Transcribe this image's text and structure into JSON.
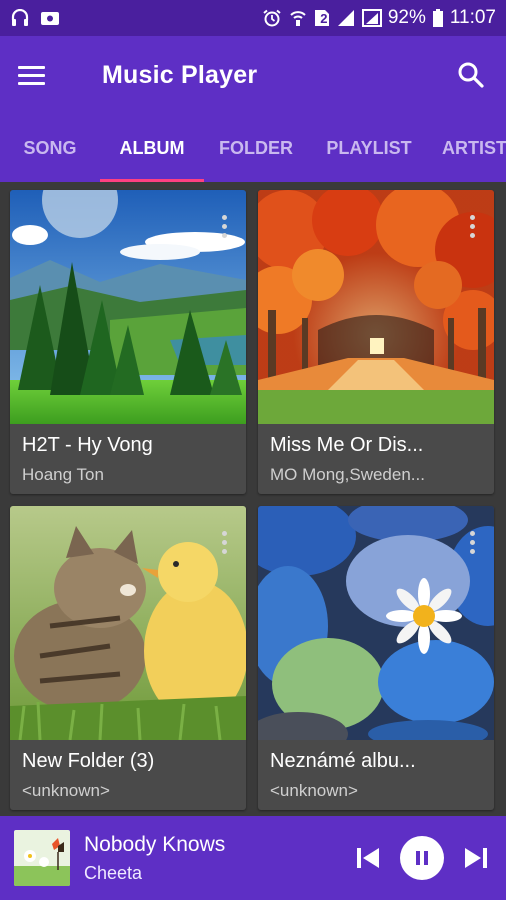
{
  "status_bar": {
    "battery_percent": "92%",
    "time": "11:07",
    "sim_label": "2",
    "icons_left": [
      "headset-icon",
      "image-notification-icon"
    ],
    "icons_right": [
      "alarm-icon",
      "wifi-calling-icon",
      "sim-icon",
      "signal-icon",
      "signal-r-icon",
      "battery-icon"
    ]
  },
  "app_bar": {
    "title": "Music Player"
  },
  "tabs": [
    {
      "label": "SONG",
      "active": false
    },
    {
      "label": "ALBUM",
      "active": true
    },
    {
      "label": "FOLDER",
      "active": false
    },
    {
      "label": "PLAYLIST",
      "active": false
    },
    {
      "label": "ARTIST",
      "active": false
    }
  ],
  "albums": [
    {
      "title": "H2T - Hy Vong",
      "artist": "Hoang Ton",
      "art": "landscape-meadow"
    },
    {
      "title": "Miss Me Or Dis...",
      "artist": "MO Mong,Sweden...",
      "art": "autumn-tree-tunnel"
    },
    {
      "title": "New Folder (3)",
      "artist": "<unknown>",
      "art": "kitten-and-duckling"
    },
    {
      "title": "Neznámé albu...",
      "artist": "<unknown>",
      "art": "pebbles-with-daisy"
    }
  ],
  "now_playing": {
    "title": "Nobody Knows",
    "artist": "Cheeta"
  },
  "colors": {
    "status_bar": "#4a1f9e",
    "primary": "#5e2fc5",
    "tab_indicator": "#ff4081",
    "background": "#3a3a3a",
    "card": "#4a4a4a"
  }
}
